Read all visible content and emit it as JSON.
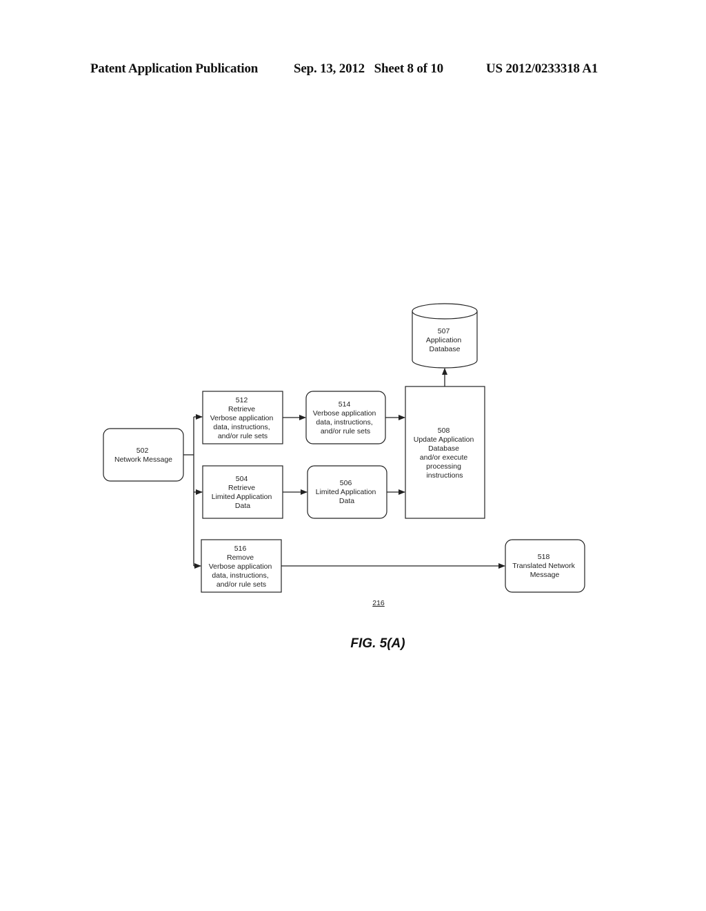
{
  "header": {
    "publication": "Patent Application Publication",
    "date_sheet": "Sep. 13, 2012   Sheet 8 of 10",
    "number": "US 2012/0233318 A1"
  },
  "nodes": {
    "n502": [
      "502",
      "Network Message"
    ],
    "n512": [
      "512",
      "Retrieve",
      "Verbose application",
      "data, instructions,",
      "and/or rule sets"
    ],
    "n514": [
      "514",
      "Verbose application",
      "data, instructions,",
      "and/or rule sets"
    ],
    "n504": [
      "504",
      "Retrieve",
      "Limited Application",
      "Data"
    ],
    "n506": [
      "506",
      "Limited Application",
      "Data"
    ],
    "n508": [
      "508",
      "Update Application",
      "Database",
      "and/or execute",
      "processing",
      "instructions"
    ],
    "n507": [
      "507",
      "Application",
      "Database"
    ],
    "n516": [
      "516",
      "Remove",
      "Verbose application",
      "data, instructions,",
      "and/or rule sets"
    ],
    "n518": [
      "518",
      "Translated Network",
      "Message"
    ]
  },
  "reference_label": "216",
  "figure_label": "FIG. 5(A)"
}
